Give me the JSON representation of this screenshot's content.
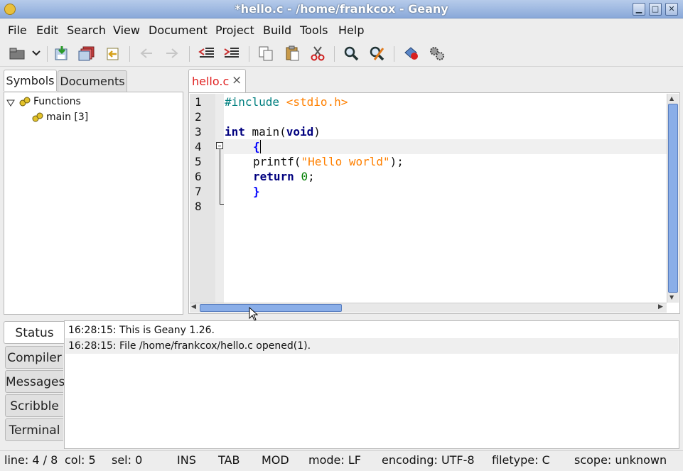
{
  "window": {
    "title": "*hello.c - /home/frankcox - Geany"
  },
  "menu": [
    "File",
    "Edit",
    "Search",
    "View",
    "Document",
    "Project",
    "Build",
    "Tools",
    "Help"
  ],
  "toolbar": {
    "icons": [
      "open-icon",
      "dropdown-icon",
      "save-icon",
      "save-all-icon",
      "revert-icon",
      "back-icon",
      "forward-icon",
      "unindent-icon",
      "indent-icon",
      "copy-icon",
      "paste-icon",
      "cut-icon",
      "find-icon",
      "replace-icon",
      "compile-icon",
      "build-icon"
    ]
  },
  "sidebar": {
    "tabs": [
      "Symbols",
      "Documents"
    ],
    "tree": {
      "group": "Functions",
      "item": "main [3]"
    }
  },
  "editor": {
    "tab_label": "hello.c",
    "close_glyph": "×",
    "line_numbers": [
      "1",
      "2",
      "3",
      "4",
      "5",
      "6",
      "7",
      "8"
    ],
    "code": {
      "l1_directive": "#include",
      "l1_header": "<stdio.h>",
      "l3_type": "int",
      "l3_name": " main(",
      "l3_void": "void",
      "l3_close": ")",
      "l4_brace": "{",
      "l5_func": "printf(",
      "l5_str": "\"Hello world\"",
      "l5_end": ");",
      "l6_kw": "return",
      "l6_num": "0",
      "l6_end": ";",
      "l7_brace": "}"
    }
  },
  "bottom": {
    "tabs": [
      "Status",
      "Compiler",
      "Messages",
      "Scribble",
      "Terminal"
    ],
    "messages": [
      "16:28:15: This is Geany 1.26.",
      "16:28:15: File /home/frankcox/hello.c opened(1)."
    ]
  },
  "statusbar": {
    "line": "line: 4 / 8",
    "col": "col: 5",
    "sel": "sel: 0",
    "ins": "INS",
    "tab": "TAB",
    "mod": "MOD",
    "mode": "mode: LF",
    "encoding": "encoding: UTF-8",
    "filetype": "filetype: C",
    "scope": "scope: unknown"
  },
  "colors": {
    "accent": "#8aa9d9",
    "tab_label": "#e02020",
    "scroll_thumb": "#8aaee8"
  }
}
